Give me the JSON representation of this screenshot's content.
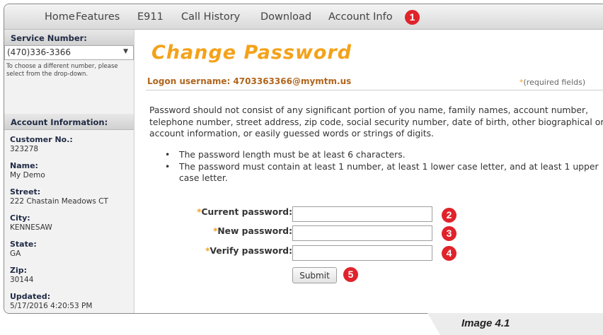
{
  "nav": {
    "items": [
      "Home",
      "Features",
      "E911",
      "Call History",
      "Download",
      "Account Info"
    ]
  },
  "callouts": [
    "1",
    "2",
    "3",
    "4",
    "5"
  ],
  "sidebar": {
    "service_number_label": "Service Number:",
    "service_number_value": "(470)336-3366",
    "select_note": "To choose a different number, please select from the drop-down.",
    "account_info_label": "Account Information:",
    "fields": [
      {
        "label": "Customer No.:",
        "value": "323278"
      },
      {
        "label": "Name:",
        "value": "My Demo"
      },
      {
        "label": "Street:",
        "value": "222 Chastain Meadows CT"
      },
      {
        "label": "City:",
        "value": "KENNESAW"
      },
      {
        "label": "State:",
        "value": "GA"
      },
      {
        "label": "Zip:",
        "value": "30144"
      },
      {
        "label": "Updated:",
        "value": "5/17/2016 4:20:53 PM"
      }
    ]
  },
  "main": {
    "title": "Change Password",
    "logon": "Logon username: 4703363366@mymtm.us",
    "required_star": "*",
    "required_text": "(required fields)",
    "paragraph": "Password should not consist of any significant portion of you name, family names, account number, telephone number, street address, zip code, social security number, date of birth, other biographical or account information, or easily guessed words or strings of digits.",
    "bullets": [
      "The password length must be at least 6 characters.",
      "The password must contain at least 1 number, at least 1 lower case letter, and at least 1 upper case letter."
    ],
    "form": {
      "star": "*",
      "current_label": "Current password:",
      "new_label": "New password:",
      "verify_label": "Verify password:",
      "current_value": "",
      "new_value": "",
      "verify_value": "",
      "submit_label": "Submit"
    }
  },
  "caption": "Image 4.1",
  "colors": {
    "callout": "#e0232b",
    "title": "#f4a21a",
    "logon": "#b0651c",
    "sidebar_label": "#1f2a44"
  }
}
